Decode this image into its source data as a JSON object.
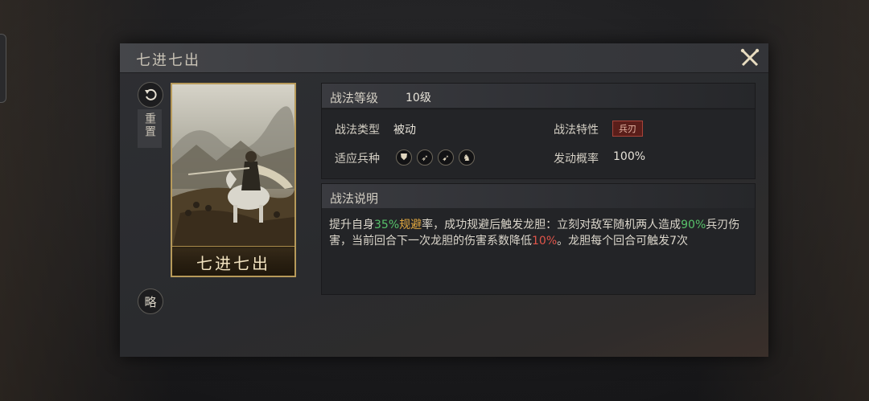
{
  "panel": {
    "title": "七进七出",
    "reset_label": "重置",
    "brief_label": "略"
  },
  "card": {
    "name": "七进七出"
  },
  "level_section": {
    "label": "战法等级",
    "value": "10级"
  },
  "attributes": {
    "type_label": "战法类型",
    "type_value": "被动",
    "trait_label": "战法特性",
    "trait_value": "兵刃",
    "units_label": "适应兵种",
    "units": [
      {
        "name": "shield-unit-icon",
        "glyph": "⛊"
      },
      {
        "name": "bow-unit-icon",
        "glyph": "➶"
      },
      {
        "name": "spear-unit-icon",
        "glyph": "➹"
      },
      {
        "name": "cavalry-unit-icon",
        "glyph": "♞"
      }
    ],
    "rate_label": "发动概率",
    "rate_value": "100%"
  },
  "description": {
    "label": "战法说明",
    "parts": {
      "p1": "提升自身",
      "p2": "35%",
      "p3": "规避",
      "p4": "率，成功规避后触发龙胆：立刻对敌军随机两人造成",
      "p5": "90%",
      "p6": "兵刃伤害，当前回合下一次龙胆的伤害系数降低",
      "p7": "10%",
      "p8": "。龙胆每个回合可触发7次"
    }
  },
  "colors": {
    "highlight_green": "#58c26a",
    "highlight_yellow": "#e0a740",
    "highlight_red": "#e0554a",
    "card_border": "#b79a5a"
  }
}
